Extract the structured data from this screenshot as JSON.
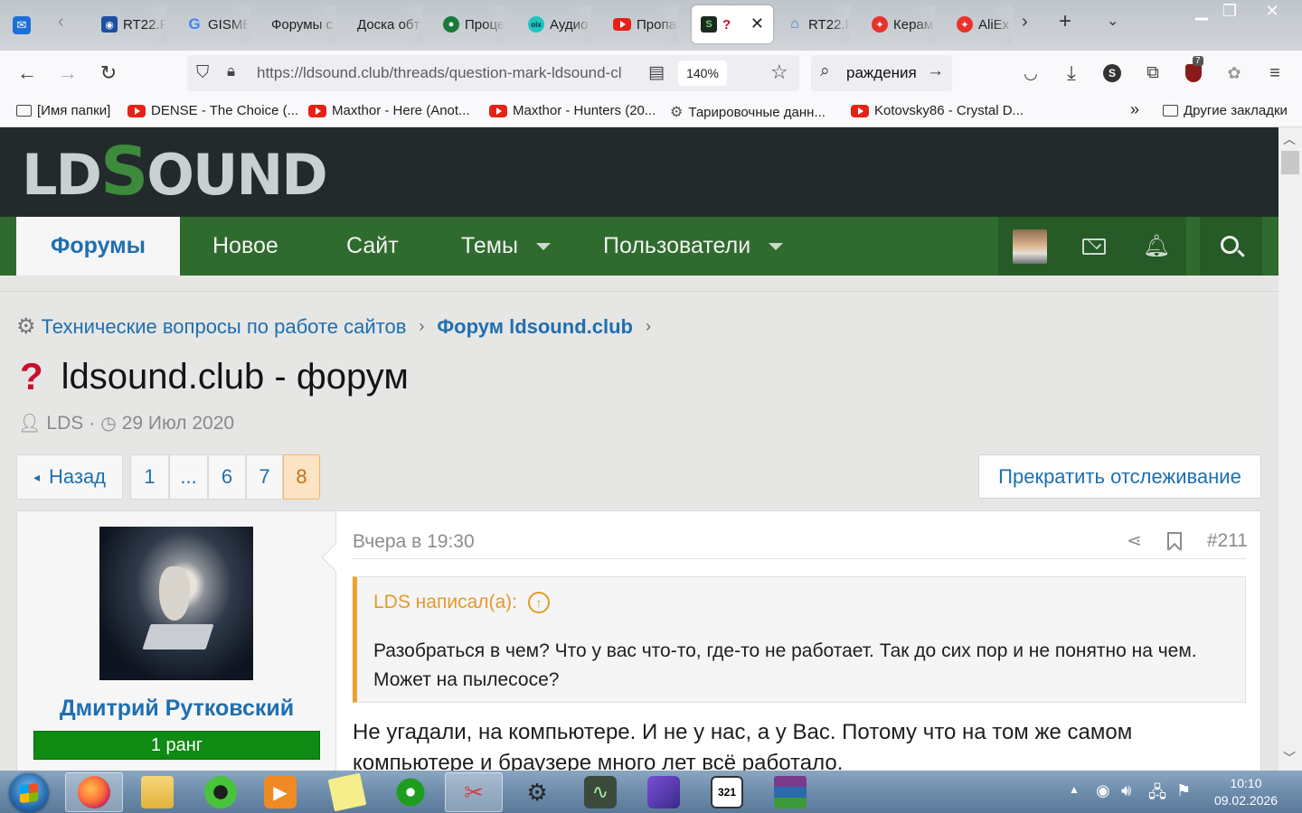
{
  "browser": {
    "tabs": [
      {
        "label": "RT22.F",
        "fav_color": "#1e4fa0",
        "fav_glyph": "◉"
      },
      {
        "label": "GISME",
        "fav_color": "#4285f4",
        "fav_glyph": "G"
      },
      {
        "label": "Форумы с",
        "fav_color": "",
        "fav_glyph": ""
      },
      {
        "label": "Доска обт",
        "fav_color": "",
        "fav_glyph": ""
      },
      {
        "label": "Проце",
        "fav_color": "#1a7a3a",
        "fav_glyph": "◎"
      },
      {
        "label": "Аудио",
        "fav_color": "#23c3c3",
        "fav_glyph": "olx"
      },
      {
        "label": "Пропа",
        "fav_color": "#e62117",
        "fav_glyph": "▶"
      },
      {
        "label": "?",
        "fav_color": "#1c2a22",
        "fav_glyph": "S",
        "active": true
      },
      {
        "label": "RT22.F",
        "fav_color": "#3f7ad6",
        "fav_glyph": "⌂"
      },
      {
        "label": "Керам",
        "fav_color": "#e8322b",
        "fav_glyph": "✦"
      },
      {
        "label": "AliEx",
        "fav_color": "#e8322b",
        "fav_glyph": "✦"
      }
    ],
    "url": "https://ldsound.club/threads/question-mark-ldsound-cl",
    "zoom": "140%",
    "search_text": "раждения",
    "extension_badge": "7"
  },
  "bookmarks": [
    {
      "label": "[Имя папки]",
      "icon": "folder"
    },
    {
      "label": "DENSE - The Choice (...",
      "icon": "youtube"
    },
    {
      "label": "Maxthor - Here (Anot...",
      "icon": "youtube"
    },
    {
      "label": "Maxthor - Hunters (20...",
      "icon": "youtube"
    },
    {
      "label": "Тарировочные данн...",
      "icon": "gear"
    },
    {
      "label": "Kotovsky86 - Crystal D...",
      "icon": "youtube"
    },
    {
      "label": "Другие закладки",
      "icon": "folder"
    }
  ],
  "site": {
    "logo_left": "LD",
    "logo_s": "S",
    "logo_right": "OUND",
    "nav": [
      {
        "label": "Форумы",
        "active": true
      },
      {
        "label": "Новое"
      },
      {
        "label": "Сайт"
      },
      {
        "label": "Темы",
        "dropdown": true
      },
      {
        "label": "Пользователи",
        "dropdown": true
      }
    ]
  },
  "breadcrumb": [
    {
      "label": "Технические вопросы по работе сайтов",
      "bold": false
    },
    {
      "label": "Форум ldsound.club",
      "bold": true
    }
  ],
  "thread": {
    "prefix": "?",
    "title": "ldsound.club - форум",
    "author": "LDS",
    "separator": "·",
    "date": "29 Июл 2020"
  },
  "pagination": {
    "back_label": "Назад",
    "pages": [
      "1",
      "...",
      "6",
      "7",
      "8"
    ],
    "current": "8",
    "watch_label": "Прекратить отслеживание"
  },
  "post": {
    "username": "Дмитрий Рутковский",
    "rank": "1 ранг",
    "time": "Вчера в 19:30",
    "number": "#211",
    "quote_author": "LDS написал(а):",
    "quote_text": "Разобраться в чем? Что у вас что-то, где-то не работает. Так до сих пор и не понятно на чем. Может на пылесосе?",
    "text": "Не угадали, на компьютере. И не у нас, а у Вас. Потому что на том же самом компьютере и браузере много лет всё работало."
  },
  "taskbar": {
    "time": "10:10",
    "date": "09.02.2026"
  },
  "colors": {
    "header_bg": "#232a2c",
    "nav_green": "#2f6b2e",
    "link_blue": "#1f6fb0",
    "rank_green": "#0f8a12",
    "quote_orange": "#e49a2b"
  }
}
